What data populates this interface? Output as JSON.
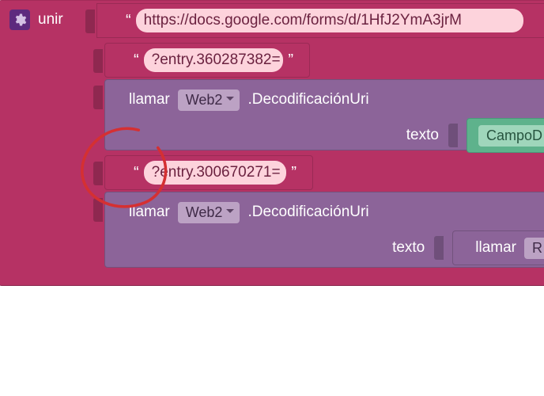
{
  "join": {
    "label": "unir",
    "gear_icon": "gear-icon"
  },
  "rows": {
    "url": "https://docs.google.com/forms/d/1HfJ2YmA3jrM",
    "entry1": "?entry.360287382=",
    "entry2": "?entry.300670271="
  },
  "call": {
    "keyword": "llamar",
    "component": "Web2",
    "method": ".DecodificaciónUri",
    "arg_label": "texto"
  },
  "getter": {
    "component_prefix": "CampoD"
  },
  "inner_call": {
    "keyword": "llamar",
    "component_prefix": "R"
  },
  "colors": {
    "magenta": "#b63264",
    "purple": "#8c6499",
    "green": "#5eb28c",
    "annotation": "#d53032"
  },
  "annotation": {
    "kind": "hand-drawn-circle"
  }
}
